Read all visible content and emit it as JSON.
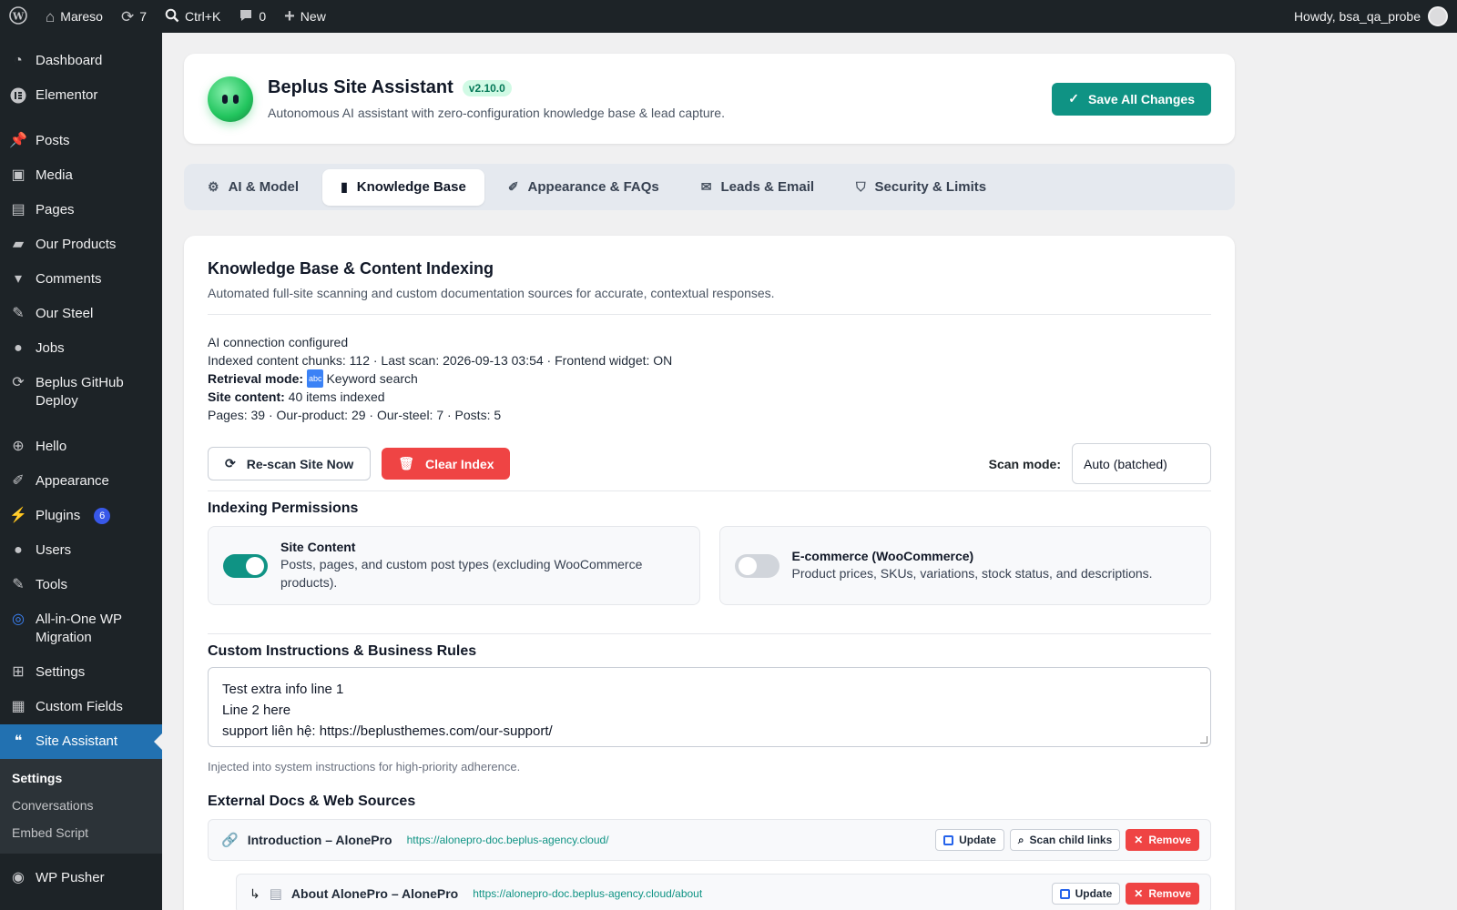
{
  "adminbar": {
    "site_name": "Mareso",
    "updates_count": "7",
    "search_shortcut": "Ctrl+K",
    "comments_count": "0",
    "new_label": "New",
    "howdy": "Howdy, bsa_qa_probe"
  },
  "sidebar": {
    "items": [
      {
        "label": "Dashboard",
        "icon": "dashboard-icon"
      },
      {
        "label": "Elementor",
        "icon": "elementor-icon"
      },
      {
        "label": "Posts",
        "icon": "pin-icon"
      },
      {
        "label": "Media",
        "icon": "media-icon"
      },
      {
        "label": "Pages",
        "icon": "pages-icon"
      },
      {
        "label": "Our Products",
        "icon": "bag-icon"
      },
      {
        "label": "Comments",
        "icon": "comment-icon"
      },
      {
        "label": "Our Steel",
        "icon": "wrench-icon"
      },
      {
        "label": "Jobs",
        "icon": "user-icon"
      },
      {
        "label": "Beplus GitHub Deploy",
        "icon": "sync-icon"
      },
      {
        "label": "Hello",
        "icon": "plus-circle-icon"
      },
      {
        "label": "Appearance",
        "icon": "brush-icon"
      },
      {
        "label": "Plugins",
        "icon": "plugin-icon",
        "badge": "6"
      },
      {
        "label": "Users",
        "icon": "users-icon"
      },
      {
        "label": "Tools",
        "icon": "tools-icon"
      },
      {
        "label": "All-in-One WP Migration",
        "icon": "migration-icon"
      },
      {
        "label": "Settings",
        "icon": "settings-icon"
      },
      {
        "label": "Custom Fields",
        "icon": "table-icon"
      },
      {
        "label": "Site Assistant",
        "icon": "chat-icon"
      },
      {
        "label": "WP Pusher",
        "icon": "circle-icon"
      }
    ],
    "submenu": [
      "Settings",
      "Conversations",
      "Embed Script"
    ]
  },
  "header": {
    "title": "Beplus Site Assistant",
    "version": "v2.10.0",
    "subtitle": "Autonomous AI assistant with zero-configuration knowledge base & lead capture.",
    "save_label": "Save All Changes"
  },
  "tabs": [
    {
      "label": "AI & Model"
    },
    {
      "label": "Knowledge Base"
    },
    {
      "label": "Appearance & FAQs"
    },
    {
      "label": "Leads & Email"
    },
    {
      "label": "Security & Limits"
    }
  ],
  "kb": {
    "title": "Knowledge Base & Content Indexing",
    "subtitle": "Automated full-site scanning and custom documentation sources for accurate, contextual responses.",
    "status_line1": "AI connection configured",
    "status_line2": "Indexed content chunks: 112 · Last scan: 2026-09-13 03:54 · Frontend widget: ON",
    "retrieval_label": "Retrieval mode:",
    "retrieval_icon": "abc",
    "retrieval_value": "Keyword search",
    "site_content_label": "Site content:",
    "site_content_value": "40 items indexed",
    "breakdown": "Pages: 39 · Our-product: 29 · Our-steel: 7 · Posts: 5",
    "rescan_label": "Re-scan Site Now",
    "clear_label": "Clear Index",
    "scan_mode_label": "Scan mode:",
    "scan_mode_value": "Auto (batched)"
  },
  "permissions": {
    "title": "Indexing Permissions",
    "site_content_title": "Site Content",
    "site_content_desc": "Posts, pages, and custom post types (excluding WooCommerce products).",
    "ecommerce_title": "E-commerce (WooCommerce)",
    "ecommerce_desc": "Product prices, SKUs, variations, stock status, and descriptions."
  },
  "instructions": {
    "title": "Custom Instructions & Business Rules",
    "line1": "Test extra info line 1",
    "line2": "Line 2 here",
    "line3": "support liên hệ: https://beplusthemes.com/our-support/",
    "hint": "Injected into system instructions for high-priority adherence."
  },
  "docs": {
    "title": "External Docs & Web Sources",
    "rows": [
      {
        "title": "Introduction – AlonePro",
        "url": "https://alonepro-doc.beplus-agency.cloud/"
      },
      {
        "title": "About AlonePro – AlonePro",
        "url": "https://alonepro-doc.beplus-agency.cloud/about"
      }
    ],
    "update_label": "Update",
    "scan_child_label": "Scan child links",
    "remove_label": "Remove",
    "child_marker": "↳"
  }
}
